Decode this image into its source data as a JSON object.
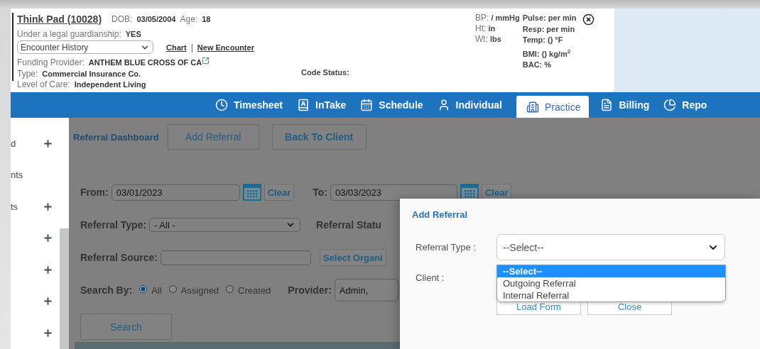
{
  "patient": {
    "name": "Think Pad (10028)",
    "dob_label": "DOB:",
    "dob": "03/05/2004",
    "age_label": "Age:",
    "age": "18",
    "guardianship_label": "Under a legal guardianship:",
    "guardianship": "YES",
    "encounter_select": "Encounter History",
    "links": [
      "Chart",
      "New Encounter"
    ],
    "link_separator": "|",
    "funding_label": "Funding Provider:",
    "funding": "ANTHEM BLUE CROSS OF CA",
    "type_label": "Type:",
    "type": "Commercial Insurance Co.",
    "care_label": "Level of Care:",
    "care": "Independent Living",
    "code_status": "Code Status:"
  },
  "vitals_left": [
    {
      "label": "BP:",
      "value": "/ mmHg"
    },
    {
      "label": "Ht:",
      "value": "in"
    },
    {
      "label": "Wt:",
      "value": "lbs"
    }
  ],
  "vitals_right": [
    "Pulse: per min",
    "Resp: per min",
    "Temp: () °F",
    "BMI: () kg/m$^{2}$",
    "BAC: %"
  ],
  "nav_tabs": [
    {
      "label": "Timesheet",
      "selected": false
    },
    {
      "label": "InTake",
      "selected": false
    },
    {
      "label": "Schedule",
      "selected": false
    },
    {
      "label": "Individual",
      "selected": false
    },
    {
      "label": "Practice",
      "selected": true
    },
    {
      "label": "Billing",
      "selected": false
    },
    {
      "label": "Repo",
      "selected": false
    }
  ],
  "sidebar": {
    "items": [
      {
        "label": "d",
        "expandable": true
      },
      {
        "label": "nts",
        "expandable": false
      },
      {
        "label": "ts",
        "expandable": true
      },
      {
        "expandable": true
      },
      {
        "expandable": true
      },
      {
        "expandable": true
      },
      {
        "expandable": true
      }
    ]
  },
  "referral_dashboard": {
    "title": "Referral Dashboard",
    "buttons": [
      "Add Referral",
      "Back To Client"
    ],
    "from": {
      "label": "From:",
      "value": "03/01/2023",
      "clear": "Clear"
    },
    "to": {
      "label": "To:",
      "value": "03/03/2023",
      "clear": "Clear"
    },
    "referral_type": {
      "label": "Referral Type:",
      "value": "- All -"
    },
    "referral_status_label": "Referral Statu",
    "referral_source": {
      "label": "Referral Source:",
      "button": "Select Organi"
    },
    "search_by": {
      "label": "Search By:",
      "options": [
        {
          "label": "All",
          "selected": true
        },
        {
          "label": "Assigned",
          "selected": false
        },
        {
          "label": "Created",
          "selected": false
        }
      ]
    },
    "provider": {
      "label": "Provider:",
      "value": "Admin,"
    },
    "search_button": "Search"
  },
  "add_referral_dialog": {
    "title": "Add Referral",
    "referral_type_label": "Referral Type :",
    "referral_type_value": "--Select--",
    "client_label": "Client :",
    "options": [
      {
        "label": "--Select--",
        "selected": true
      },
      {
        "label": "Outgoing Referral",
        "selected": false
      },
      {
        "label": "Internal Referral",
        "selected": false
      }
    ],
    "buttons": [
      "Load Form",
      "Close"
    ]
  }
}
